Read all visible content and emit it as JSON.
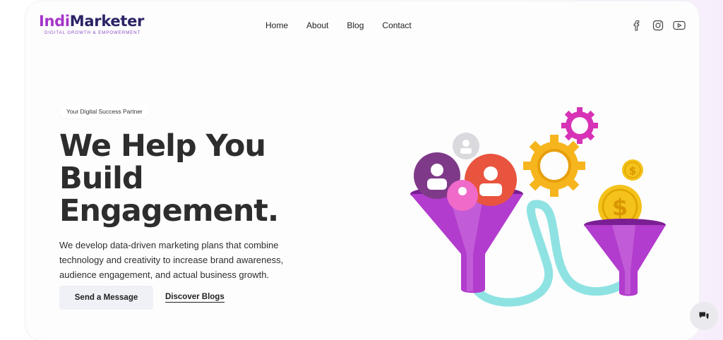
{
  "brand": {
    "name_part1": "Indi",
    "name_part2": "Marketer",
    "tagline": "DIGITAL GROWTH & EMPOWERMENT"
  },
  "nav": [
    {
      "label": "Home"
    },
    {
      "label": "About"
    },
    {
      "label": "Blog"
    },
    {
      "label": "Contact"
    }
  ],
  "social": [
    "facebook-icon",
    "instagram-icon",
    "youtube-icon"
  ],
  "hero": {
    "badge": "Your Digital Success Partner",
    "headline_lines": [
      "We Help You",
      "Build",
      "Engagement."
    ],
    "description": "We develop data-driven marketing plans that combine technology and creativity to increase brand awareness, audience engagement, and actual business growth.",
    "primary_button": "Send a Message",
    "secondary_link": "Discover Blogs"
  },
  "colors": {
    "brand_purple": "#a636c9",
    "brand_navy": "#2b2366",
    "funnel": "#b23ccd",
    "tube": "#8fe2e2",
    "gear": "#f6b51c",
    "gear_pink": "#d733b6"
  },
  "chat": {
    "icon": "chat-icon"
  }
}
